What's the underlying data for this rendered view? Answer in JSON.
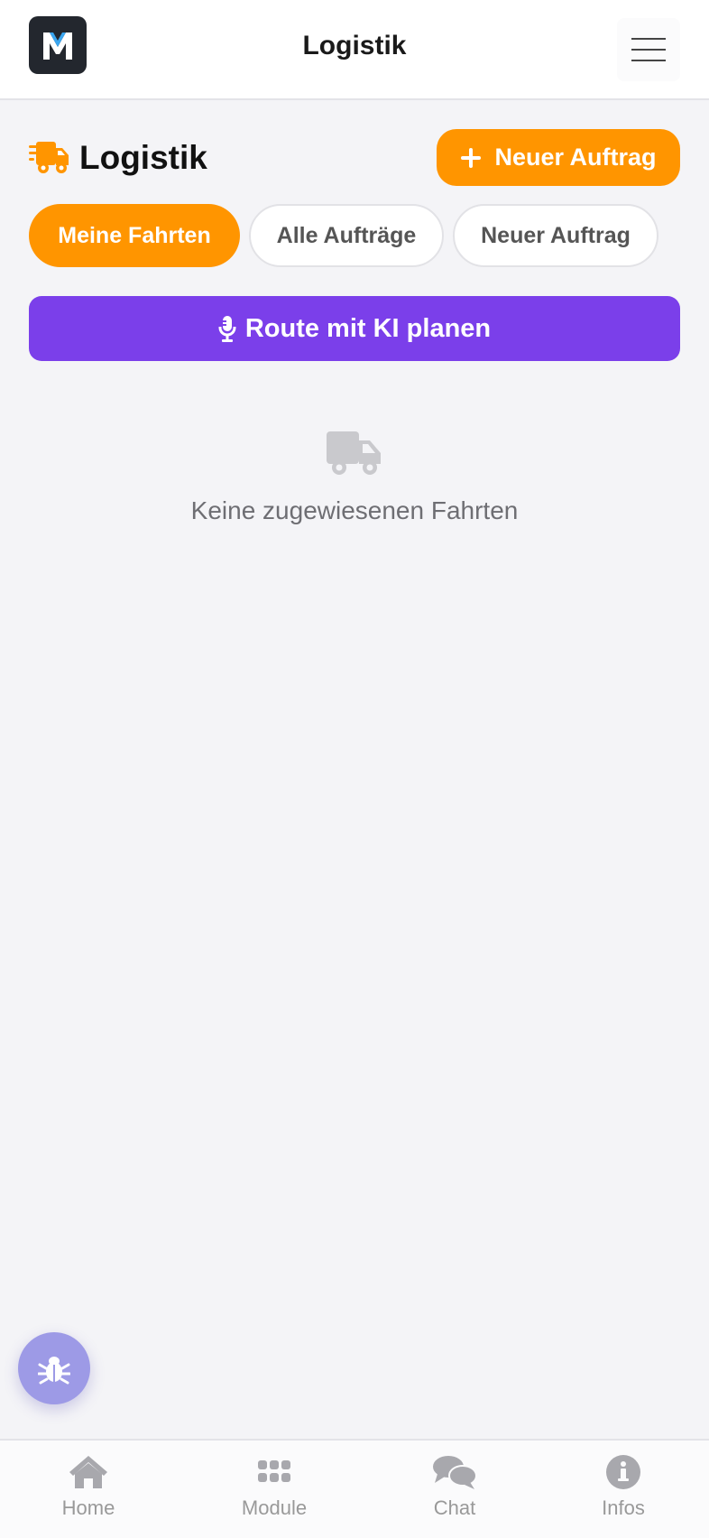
{
  "header": {
    "title": "Logistik",
    "logo_letter": "M",
    "menu_icon": "hamburger-icon"
  },
  "page": {
    "title": "Logistik",
    "title_icon": "truck-fast-icon",
    "new_order_button": "Neuer Auftrag"
  },
  "tabs": [
    {
      "label": "Meine Fahrten",
      "active": true
    },
    {
      "label": "Alle Aufträge",
      "active": false
    },
    {
      "label": "Neuer Auftrag",
      "active": false
    }
  ],
  "ki_button": {
    "label": "Route mit KI planen",
    "icon": "microphone-icon"
  },
  "empty_state": {
    "icon": "truck-icon",
    "text": "Keine zugewiesenen Fahrten"
  },
  "fab": {
    "icon": "bug-icon"
  },
  "bottom_nav": [
    {
      "label": "Home",
      "icon": "home-icon"
    },
    {
      "label": "Module",
      "icon": "grid-icon"
    },
    {
      "label": "Chat",
      "icon": "chat-icon"
    },
    {
      "label": "Infos",
      "icon": "info-icon"
    }
  ],
  "colors": {
    "accent_orange": "#ff9500",
    "ki_purple": "#7b3fea",
    "fab_purple": "#9d9ae6",
    "background": "#f4f4f7"
  }
}
